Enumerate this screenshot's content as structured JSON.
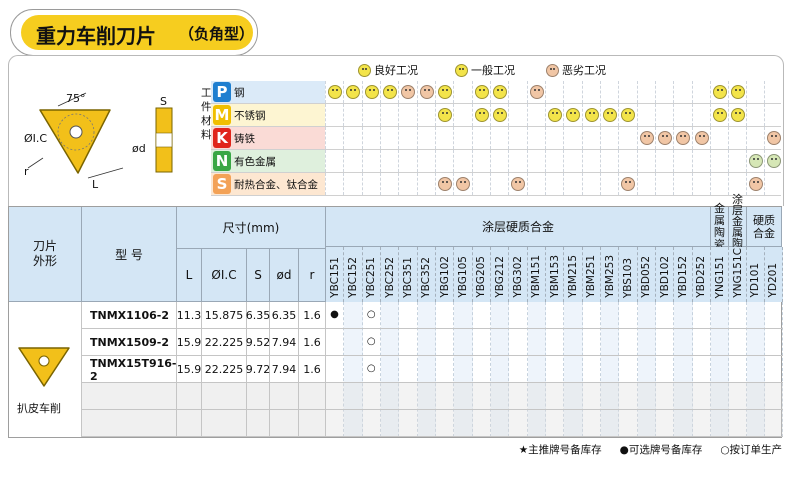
{
  "title": {
    "main": "重力车削刀片",
    "sub": "（负角型）"
  },
  "legend": [
    {
      "icon": "good-face-icon",
      "label": "良好工况"
    },
    {
      "icon": "neutral-face-icon",
      "label": "一般工况"
    },
    {
      "icon": "bad-face-icon",
      "label": "恶劣工况"
    }
  ],
  "material_label": "工件材料",
  "materials": [
    {
      "letter": "P",
      "name": "钢",
      "color": "#1f7fd0",
      "bg": "#dbeaf8"
    },
    {
      "letter": "M",
      "name": "不锈钢",
      "color": "#f0bf00",
      "bg": "#fdf5d2"
    },
    {
      "letter": "K",
      "name": "铸铁",
      "color": "#e0251b",
      "bg": "#fadbd6"
    },
    {
      "letter": "N",
      "name": "有色金属",
      "color": "#3aa745",
      "bg": "#dff0dd"
    },
    {
      "letter": "S",
      "name": "耐热合金、钛合金",
      "color": "#f3a257",
      "bg": "#fde7d1"
    }
  ],
  "drawing": {
    "angle": "75°",
    "ic": "ØI.C",
    "r": "r",
    "L": "L",
    "S": "S",
    "d": "ød"
  },
  "table": {
    "shape_header": "刀片外形",
    "model_header": "型 号",
    "size_header": "尺寸(mm)",
    "size_cols": [
      "L",
      "ØI.C",
      "S",
      "ød",
      "r"
    ],
    "coated_header": "涂层硬质合金",
    "cermet_header": "金属陶瓷",
    "coated_cermet_header": "涂层金属陶瓷",
    "carbide_header": "硬质合金",
    "grades": [
      "YBC151",
      "YBC152",
      "YBC251",
      "YBC252",
      "YBC351",
      "YBC352",
      "YBG102",
      "YBG105",
      "YBG205",
      "YBG212",
      "YBG302",
      "YBM151",
      "YBM153",
      "YBM215",
      "YBM251",
      "YBM253",
      "YBS103",
      "YBD052",
      "YBD102",
      "YBD152",
      "YBD252",
      "YNG151",
      "YNG151C",
      "YD101",
      "YD201"
    ],
    "rows": [
      {
        "model": "TNMX1106-2",
        "L": "11.3",
        "ic": "15.875",
        "S": "6.35",
        "d": "6.35",
        "r": "1.6",
        "marks": {
          "0": "●",
          "2": "○"
        }
      },
      {
        "model": "TNMX1509-2",
        "L": "15.9",
        "ic": "22.225",
        "S": "9.52",
        "d": "7.94",
        "r": "1.6",
        "marks": {
          "2": "○"
        }
      },
      {
        "model": "TNMX15T916-2",
        "L": "15.9",
        "ic": "22.225",
        "S": "9.72",
        "d": "7.94",
        "r": "1.6",
        "marks": {
          "2": "○"
        }
      }
    ],
    "shape_caption": "扒皮车削"
  },
  "footnote": [
    "★主推牌号备库存",
    "●可选牌号备库存",
    "○按订单生产"
  ],
  "faces": {
    "P": {
      "0": "good",
      "1": "good",
      "2": "neutral",
      "3": "good",
      "4": "bad",
      "5": "bad",
      "6": "good",
      "8": "good",
      "9": "good",
      "11": "bad",
      "21": "good",
      "22": "good"
    },
    "M": {
      "6": "neutral",
      "8": "neutral",
      "9": "neutral",
      "12": "neutral",
      "13": "good",
      "14": "good",
      "15": "neutral",
      "16": "neutral",
      "21": "neutral",
      "22": "good"
    },
    "K": {
      "17": "bad",
      "18": "bad",
      "19": "bad",
      "20": "bad",
      "24": "bad"
    },
    "N": {
      "23": "green",
      "24": "green"
    },
    "S": {
      "6": "bad",
      "7": "bad",
      "10": "bad",
      "16": "bad",
      "23": "bad"
    }
  }
}
